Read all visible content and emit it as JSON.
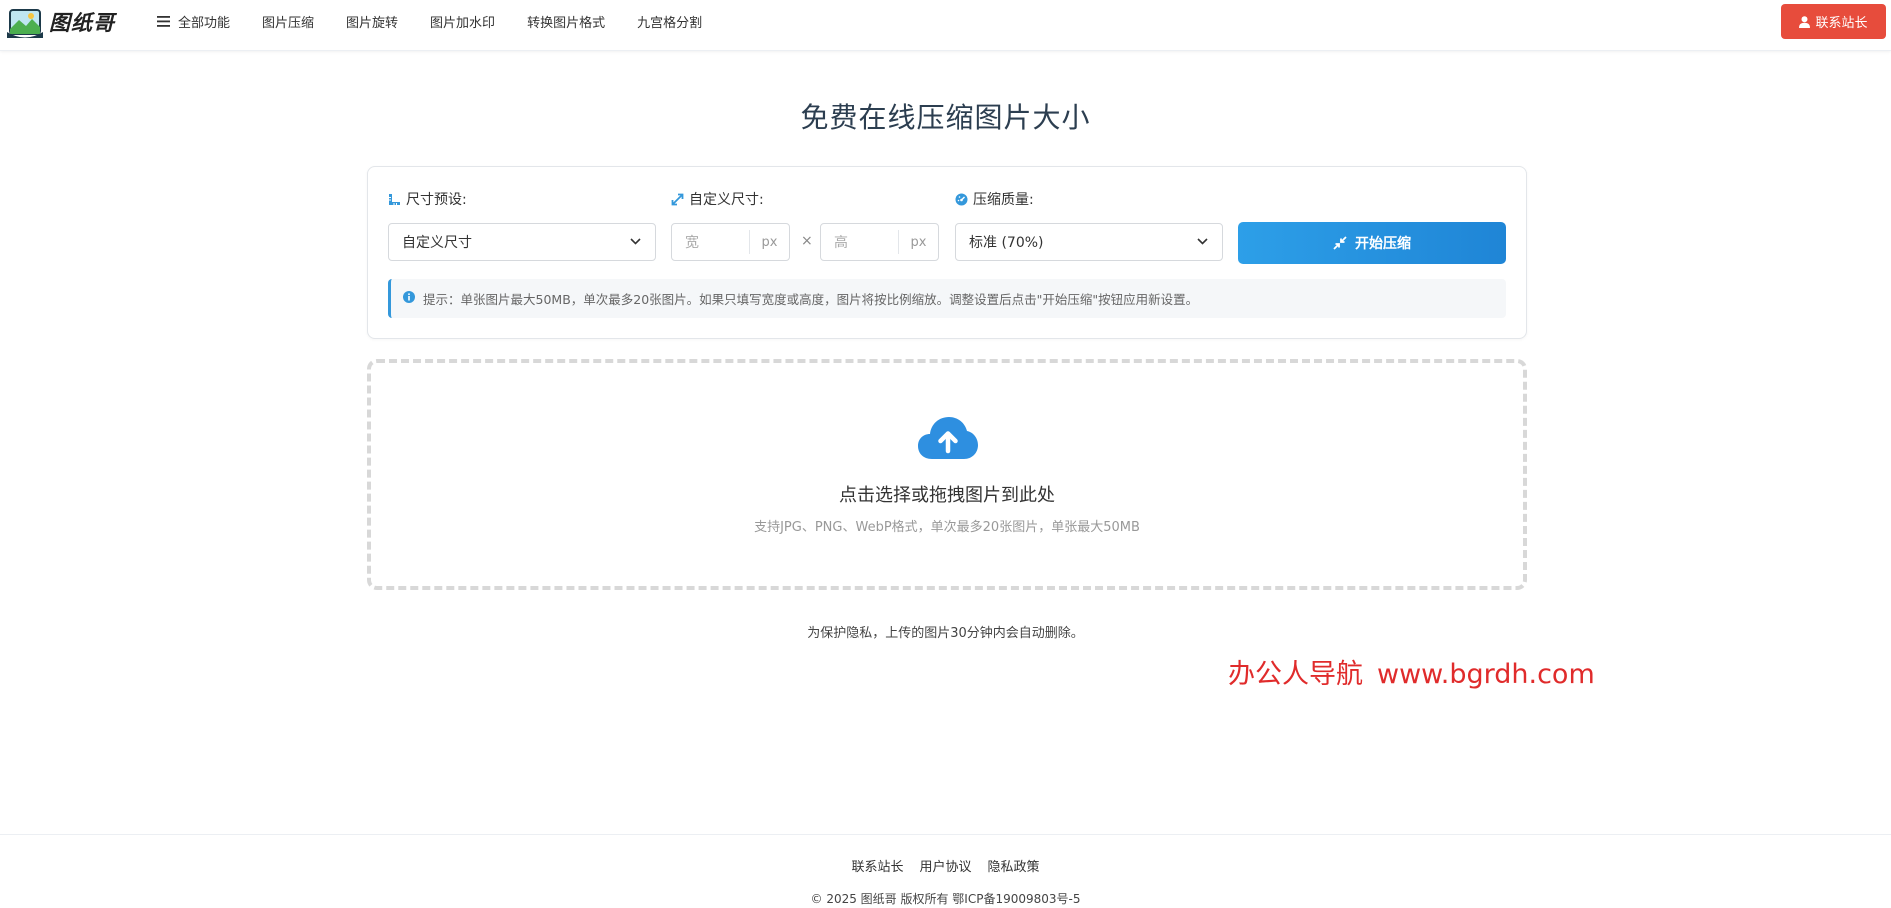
{
  "header": {
    "logo_text": "图纸哥",
    "nav": [
      {
        "label": "全部功能",
        "icon": "menu-icon"
      },
      {
        "label": "图片压缩"
      },
      {
        "label": "图片旋转"
      },
      {
        "label": "图片加水印"
      },
      {
        "label": "转换图片格式"
      },
      {
        "label": "九宫格分割"
      }
    ],
    "contact_button": "联系站长"
  },
  "title": "免费在线压缩图片大小",
  "settings": {
    "size_preset_label": "尺寸预设:",
    "size_preset_value": "自定义尺寸",
    "custom_size_label": "自定义尺寸:",
    "width_placeholder": "宽",
    "height_placeholder": "高",
    "unit": "px",
    "times_symbol": "×",
    "quality_label": "压缩质量:",
    "quality_value": "标准 (70%)",
    "start_button": "开始压缩",
    "tip": "提示：单张图片最大50MB，单次最多20张图片。如果只填写宽度或高度，图片将按比例缩放。调整设置后点击\"开始压缩\"按钮应用新设置。"
  },
  "upload": {
    "title": "点击选择或拖拽图片到此处",
    "subtitle": "支持JPG、PNG、WebP格式，单次最多20张图片，单张最大50MB"
  },
  "privacy_note": "为保护隐私，上传的图片30分钟内会自动删除。",
  "watermark": {
    "name": "办公人导航",
    "url": "www.bgrdh.com"
  },
  "footer": {
    "links": [
      "联系站长",
      "用户协议",
      "隐私政策"
    ],
    "copyright": "© 2025 图纸哥 版权所有 鄂ICP备19009803号-5"
  },
  "colors": {
    "accent_blue": "#2d9fe8",
    "contact_red": "#e74c3c",
    "watermark_red": "#e02b2b"
  }
}
